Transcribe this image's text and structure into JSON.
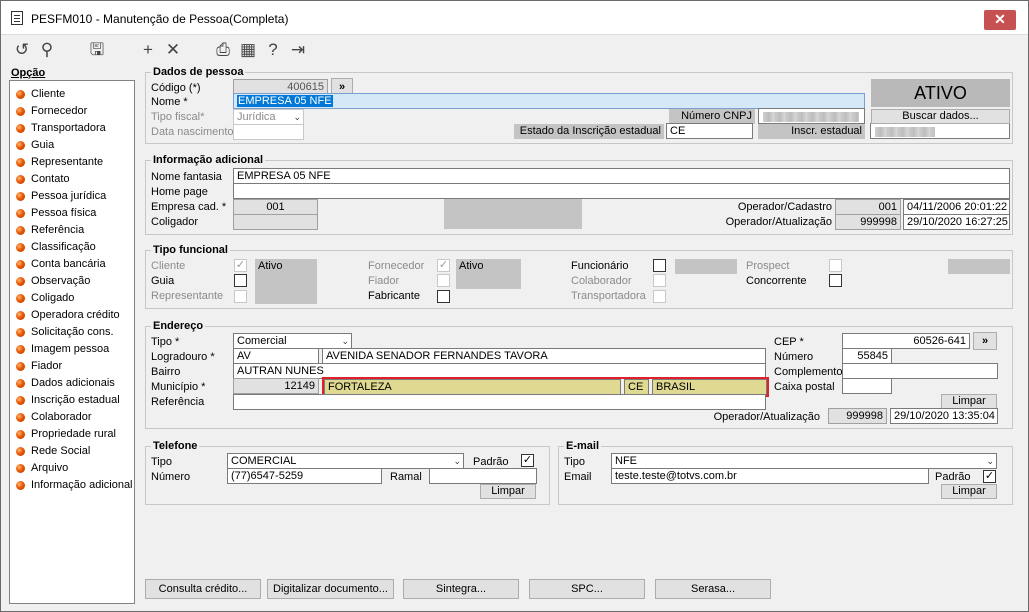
{
  "window": {
    "title": "PESFM010 - Manutenção de Pessoa(Completa)",
    "close_icon": "close-icon"
  },
  "toolbar": {
    "icons": [
      "undo-icon",
      "search-icon",
      "save-icon",
      "add-icon",
      "delete-icon",
      "print-icon",
      "calendar-icon",
      "help-icon",
      "exit-icon"
    ]
  },
  "sidebar": {
    "title": "Opção",
    "items": [
      "Cliente",
      "Fornecedor",
      "Transportadora",
      "Guia",
      "Representante",
      "Contato",
      "Pessoa jurídica",
      "Pessoa física",
      "Referência",
      "Classificação",
      "Conta bancária",
      "Observação",
      "Coligado",
      "Operadora crédito",
      "Solicitação cons.",
      "Imagem pessoa",
      "Fiador",
      "Dados adicionais",
      "Inscrição estadual",
      "Colaborador",
      "Propriedade rural",
      "Rede Social",
      "Arquivo",
      "Informação adicional"
    ]
  },
  "dados": {
    "title": "Dados de pessoa",
    "codigo_label": "Código (*)",
    "codigo": "400615",
    "lookup_btn": "»",
    "nome_label": "Nome *",
    "nome": "EMPRESA 05 NFE",
    "tipo_fiscal_label": "Tipo fiscal*",
    "tipo_fiscal": "Jurídica",
    "data_nasc_label": "Data nascimento",
    "cnpj_label": "Número CNPJ",
    "estado_ie_label": "Estado da Inscrição estadual",
    "estado_ie": "CE",
    "inscr_label": "Inscr. estadual",
    "status": "ATIVO",
    "buscar_btn": "Buscar dados..."
  },
  "info": {
    "title": "Informação adicional",
    "fantasia_label": "Nome fantasia",
    "fantasia": "EMPRESA 05 NFE",
    "home_label": "Home page",
    "empresa_label": "Empresa cad. *",
    "empresa": "001",
    "coligador_label": "Coligador",
    "op_cad_label": "Operador/Cadastro",
    "op_cad": "001",
    "dt_cad": "04/11/2006 20:01:22",
    "op_at_label": "Operador/Atualização",
    "op_at": "999998",
    "dt_at": "29/10/2020 16:27:25"
  },
  "funcional": {
    "title": "Tipo funcional",
    "cliente": "Cliente",
    "guia": "Guia",
    "representante": "Representante",
    "ativo1": "Ativo",
    "fornecedor": "Fornecedor",
    "fiador": "Fiador",
    "fabricante": "Fabricante",
    "ativo2": "Ativo",
    "funcionario": "Funcionário",
    "colaborador": "Colaborador",
    "transportadora": "Transportadora",
    "prospect": "Prospect",
    "concorrente": "Concorrente"
  },
  "endereco": {
    "title": "Endereço",
    "tipo_label": "Tipo *",
    "tipo": "Comercial",
    "logradouro_label": "Logradouro *",
    "logr_tipo": "AV",
    "logradouro": "AVENIDA SENADOR FERNANDES TAVORA",
    "bairro_label": "Bairro",
    "bairro": "AUTRAN NUNES",
    "municipio_label": "Município *",
    "mun_cod": "12149",
    "municipio": "FORTALEZA",
    "uf": "CE",
    "pais": "BRASIL",
    "referencia_label": "Referência",
    "cep_label": "CEP *",
    "cep": "60526-641",
    "cep_btn": "»",
    "numero_label": "Número",
    "numero": "55845",
    "complemento_label": "Complemento",
    "caixa_label": "Caixa postal",
    "limpar": "Limpar",
    "op_at_label": "Operador/Atualização",
    "op_at": "999998",
    "dt_at": "29/10/2020 13:35:04"
  },
  "telefone": {
    "title": "Telefone",
    "tipo_label": "Tipo",
    "tipo": "COMERCIAL",
    "padrao_label": "Padrão",
    "numero_label": "Número",
    "numero": "(77)6547-5259",
    "ramal_label": "Ramal",
    "limpar": "Limpar"
  },
  "email": {
    "title": "E-mail",
    "tipo_label": "Tipo",
    "tipo": "NFE",
    "email_label": "Email",
    "email": "teste.teste@totvs.com.br",
    "padrao_label": "Padrão",
    "limpar": "Limpar"
  },
  "footer": {
    "buttons": [
      "Consulta crédito...",
      "Digitalizar documento...",
      "Sintegra...",
      "SPC...",
      "Serasa..."
    ]
  }
}
